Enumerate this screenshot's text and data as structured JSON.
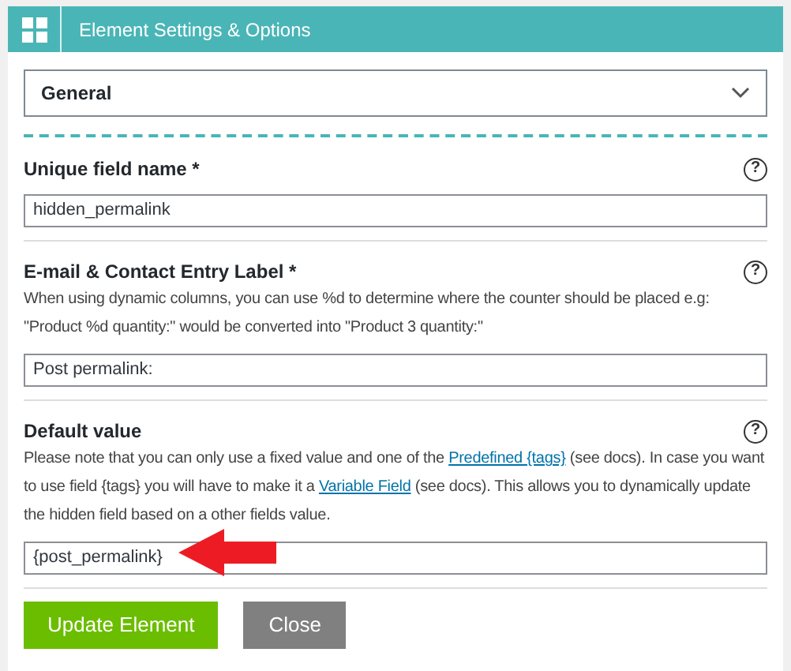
{
  "window": {
    "title": "Element Settings & Options"
  },
  "tab_select": {
    "value": "General"
  },
  "fields": [
    {
      "label": "Unique field name *",
      "help": "?",
      "value": "hidden_permalink",
      "annotated": false
    },
    {
      "label": "E-mail & Contact Entry Label *",
      "help": "?",
      "description": [
        [
          {
            "kind": "text",
            "text": "When using dynamic columns, you can use %d to determine where the counter should be placed e.g:"
          }
        ],
        [
          {
            "kind": "text",
            "text": "\"Product %d quantity:\" would be converted into \"Product 3 quantity:\""
          }
        ]
      ],
      "value": "Post permalink:",
      "annotated": false
    },
    {
      "label": "Default value",
      "help": "?",
      "description": [
        [
          {
            "kind": "text",
            "text": "Please note that you can only use a fixed value and one of the "
          },
          {
            "kind": "link",
            "text": "Predefined {tags}"
          },
          {
            "kind": "text",
            "text": " (see docs). In case you want to use field {tags} you will have to make it a "
          },
          {
            "kind": "link",
            "text": "Variable Field"
          },
          {
            "kind": "text",
            "text": " (see docs). This allows you to dynamically update the hidden field based on a other fields value."
          }
        ]
      ],
      "value": "{post_permalink}",
      "annotated": true
    }
  ],
  "buttons": [
    {
      "label": "Update Element",
      "kind": "primary"
    },
    {
      "label": "Close",
      "kind": "secondary"
    }
  ]
}
